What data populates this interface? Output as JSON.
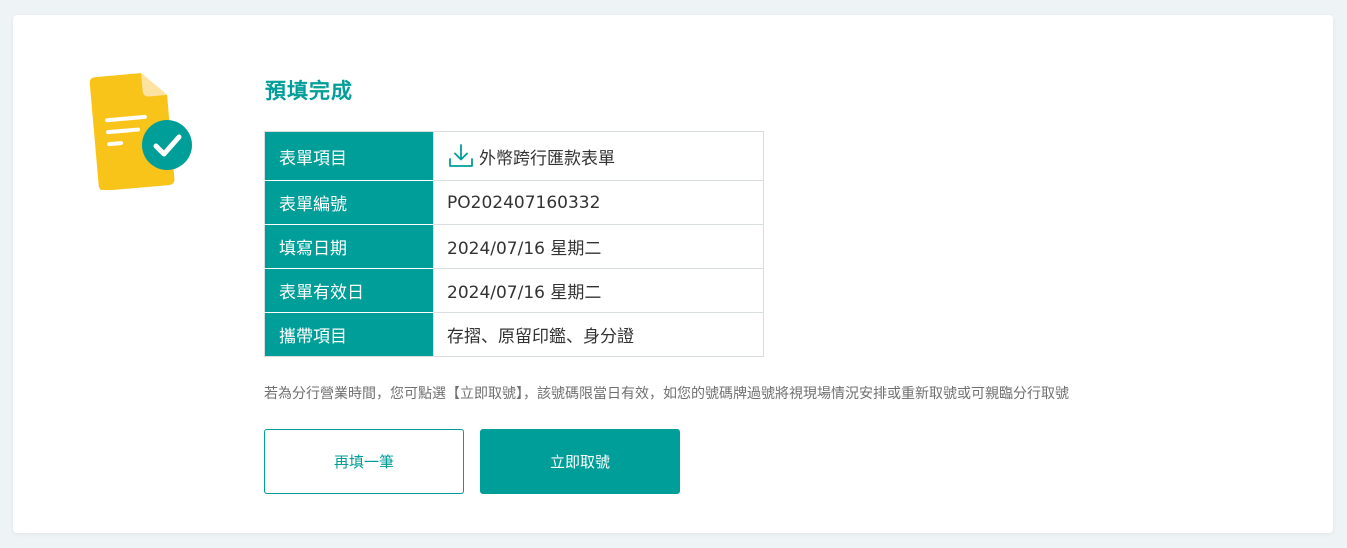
{
  "result": {
    "title": "預填完成"
  },
  "details": {
    "rows": [
      {
        "label": "表單項目",
        "value": "外幣跨行匯款表單"
      },
      {
        "label": "表單編號",
        "value": "PO202407160332"
      },
      {
        "label": "填寫日期",
        "value": "2024/07/16 星期二"
      },
      {
        "label": "表單有效日",
        "value": "2024/07/16 星期二"
      },
      {
        "label": "攜帶項目",
        "value": "存摺、原留印鑑、身分證"
      }
    ]
  },
  "notice": "若為分行營業時間，您可點選【立即取號】，該號碼限當日有效，如您的號碼牌過號將視現場情況安排或重新取號或可親臨分行取號",
  "actions": {
    "refill_label": "再填一筆",
    "take_number_label": "立即取號"
  },
  "icons": {
    "illustration": "document-check-icon",
    "form_download": "download-icon"
  },
  "colors": {
    "primary": "#009e98",
    "accent": "#e07a25",
    "doc_yellow": "#f9c41a",
    "page_bg": "#eef3f6"
  }
}
